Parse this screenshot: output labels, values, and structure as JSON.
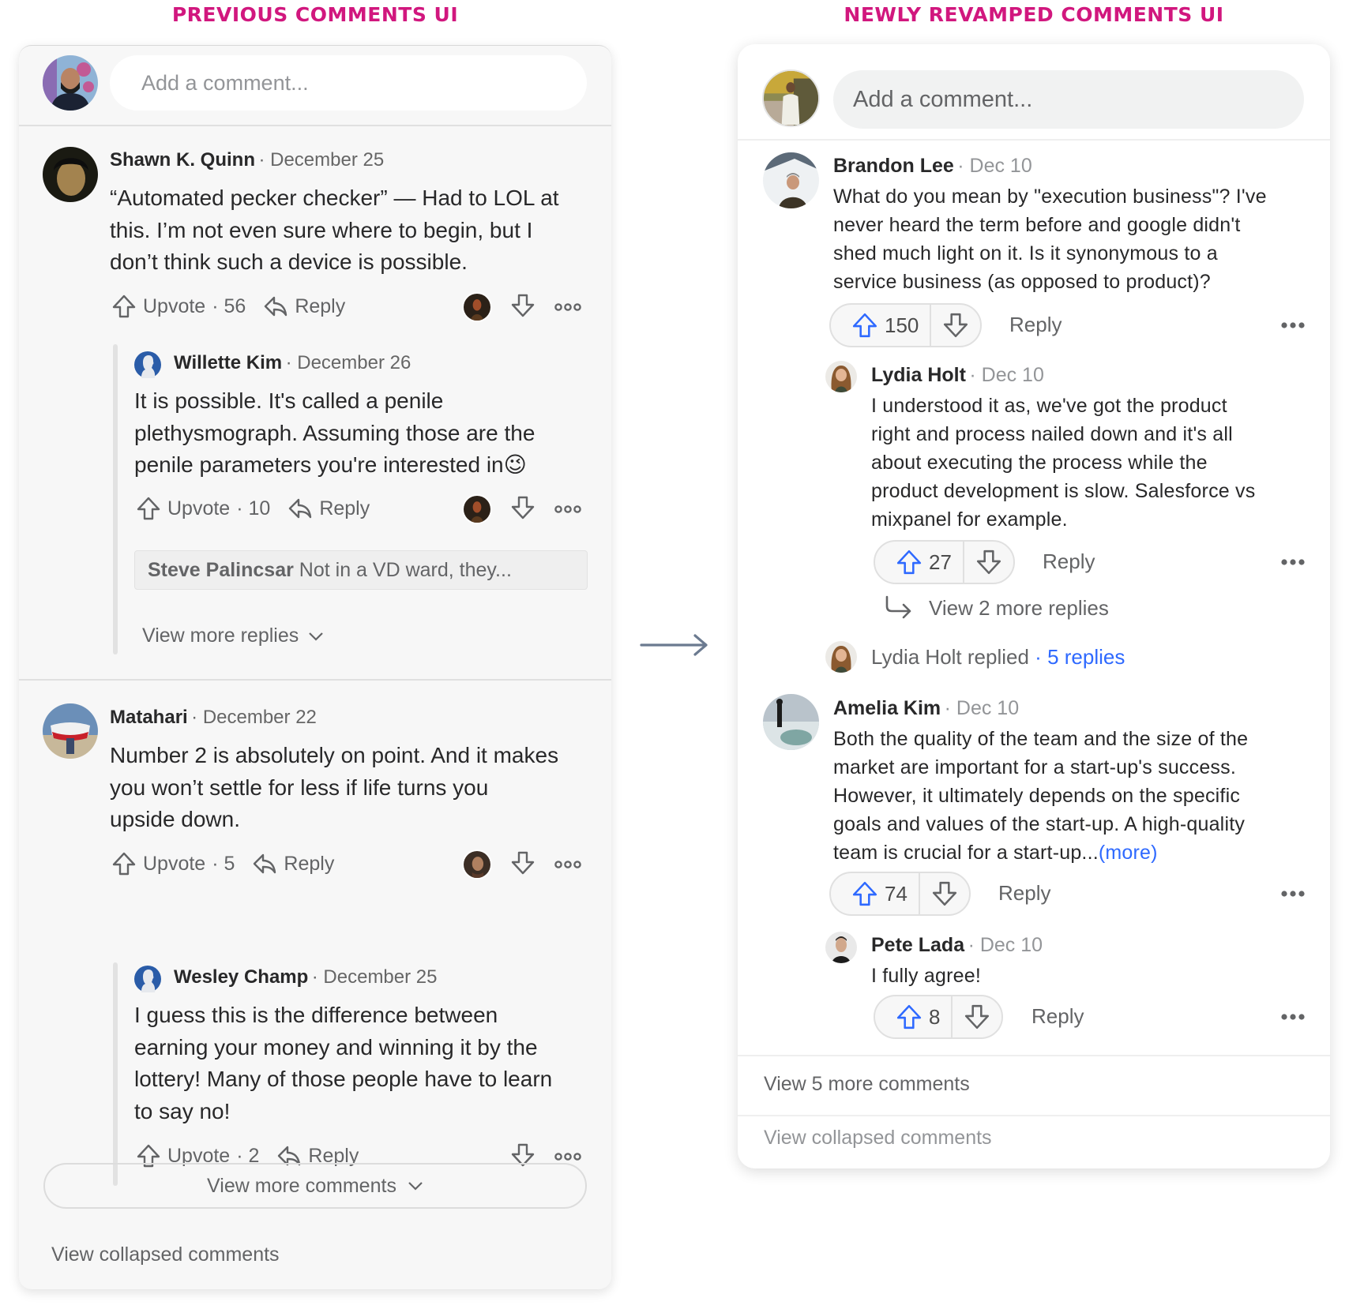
{
  "titles": {
    "left": "PREVIOUS COMMENTS UI",
    "right": "NEWLY REVAMPED COMMENTS UI"
  },
  "colors": {
    "title_accent": "#d1177e",
    "link_blue": "#2e69ff",
    "arrow": "#6b7a90"
  },
  "old_ui": {
    "composer": {
      "placeholder": "Add a comment..."
    },
    "comments": [
      {
        "author": "Shawn K. Quinn",
        "date": "· December 25",
        "lines": [
          "“Automated pecker checker” — Had to LOL at",
          "this. I’m not even sure where to begin, but I",
          "don’t think such a device is possible."
        ],
        "upvote_label": "Upvote",
        "upvotes": "· 56",
        "reply_label": "Reply",
        "replies": [
          {
            "author": "Willette Kim",
            "date": "· December 26",
            "lines": [
              "It is possible. It's called a penile",
              "plethysmograph. Assuming those are the",
              "penile parameters you're interested in"
            ],
            "emoji": "😉",
            "upvote_label": "Upvote",
            "upvotes": "· 10",
            "reply_label": "Reply"
          }
        ],
        "collapsed_preview": {
          "author": "Steve Palincsar",
          "text": "Not in a VD ward, they..."
        },
        "view_more_replies": "View more replies"
      },
      {
        "author": "Matahari",
        "date": "· December 22",
        "lines": [
          "Number 2 is absolutely on point. And it makes",
          "you won’t settle for less if life turns you",
          "upside down."
        ],
        "upvote_label": "Upvote",
        "upvotes": "· 5",
        "reply_label": "Reply",
        "replies": [
          {
            "author": "Wesley Champ",
            "date": "· December 25",
            "lines": [
              "I guess this is the difference between",
              "earning your money and winning it by the",
              "lottery! Many of those people have to learn",
              "to say no!"
            ],
            "upvote_label": "Upvote",
            "upvotes": "· 2",
            "reply_label": "Reply"
          }
        ]
      }
    ],
    "view_more_comments": "View more comments",
    "view_collapsed": "View collapsed comments"
  },
  "new_ui": {
    "composer": {
      "placeholder": "Add a comment..."
    },
    "comments": [
      {
        "author": "Brandon Lee",
        "date": "· Dec 10",
        "lines": [
          "What do you mean by \"execution business\"? I've",
          "never heard the term before and google didn't",
          "shed much light on it. Is it synonymous to a",
          "service business (as opposed to product)?"
        ],
        "upvotes": "150",
        "reply_label": "Reply",
        "replies": [
          {
            "author": "Lydia Holt",
            "date": "· Dec 10",
            "lines": [
              "I understood it as, we've got the product",
              "right and process nailed down and it's all",
              "about executing the process while the",
              "product development is slow. Salesforce vs",
              "mixpanel for example."
            ],
            "upvotes": "27",
            "reply_label": "Reply",
            "view_more": "View 2 more replies"
          }
        ],
        "replied_summary": {
          "text": "Lydia Holt replied",
          "sep": "·",
          "count": "5 replies"
        }
      },
      {
        "author": "Amelia Kim",
        "date": "· Dec 10",
        "lines": [
          "Both the quality of the team and the size of the",
          "market are important for a start-up's success.",
          "However, it ultimately depends on the specific",
          "goals and values of the start-up. A high-quality"
        ],
        "last_line": "team is crucial for a start-up...",
        "more_link": "(more)",
        "upvotes": "74",
        "reply_label": "Reply",
        "replies": [
          {
            "author": "Pete Lada",
            "date": "· Dec 10",
            "lines": [
              "I fully agree!"
            ],
            "upvotes": "8",
            "reply_label": "Reply"
          }
        ]
      }
    ],
    "view_more_comments": "View 5 more comments",
    "view_collapsed": "View collapsed comments"
  }
}
